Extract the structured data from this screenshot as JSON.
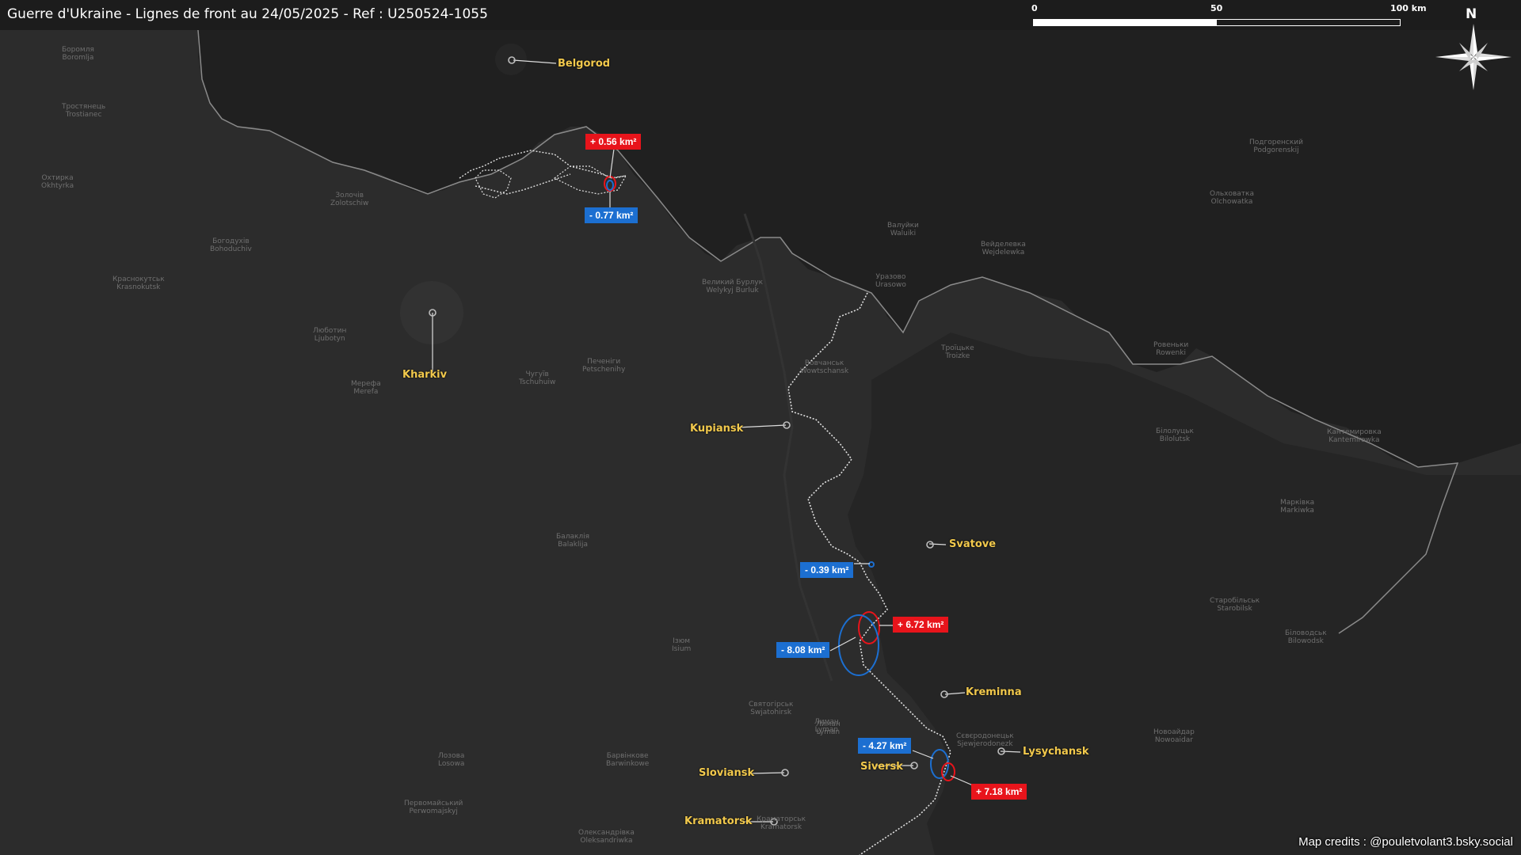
{
  "title": "Guerre d'Ukraine - Lignes de front au 24/05/2025 - Ref : U250524-1055",
  "scale": {
    "labels": [
      "0",
      "50",
      "100 km"
    ]
  },
  "north": {
    "label": "N",
    "icon": "compass-rose-icon"
  },
  "cities": [
    {
      "name": "Belgorod"
    },
    {
      "name": "Kharkiv"
    },
    {
      "name": "Kupiansk"
    },
    {
      "name": "Svatove"
    },
    {
      "name": "Kreminna"
    },
    {
      "name": "Lysychansk"
    },
    {
      "name": "Siversk"
    },
    {
      "name": "Sloviansk"
    },
    {
      "name": "Kramatorsk"
    }
  ],
  "changes": [
    {
      "label": "+ 0.56 km²",
      "type": "gain",
      "area_km2": 0.56
    },
    {
      "label": "- 0.77 km²",
      "type": "loss",
      "area_km2": -0.77
    },
    {
      "label": "- 0.39 km²",
      "type": "loss",
      "area_km2": -0.39
    },
    {
      "label": "+ 6.72 km²",
      "type": "gain",
      "area_km2": 6.72
    },
    {
      "label": "- 8.08 km²",
      "type": "loss",
      "area_km2": -8.08
    },
    {
      "label": "- 4.27 km²",
      "type": "loss",
      "area_km2": -4.27
    },
    {
      "label": "+ 7.18 km²",
      "type": "gain",
      "area_km2": 7.18
    }
  ],
  "background_labels": [
    "Боромля\nBoromlja",
    "Тростянець\nTrostianec",
    "Охтирка\nOkhtyrka",
    "Богодухів\nBohoduchiv",
    "Золочів\nZolotschiw",
    "Краснокутськ\nKrasnokutsk",
    "Люботин\nLjubotyn",
    "Мерефа\nMerefa",
    "Чугуїв\nTschuhuiw",
    "Печеніги\nPetschenihy",
    "Балаклія\nBalaklija",
    "Ізюм\nIsium",
    "Вовчанськ\nWowtschansk",
    "Великий Бурлук\nWelykyj Burluk",
    "Троїцьке\nTroizke",
    "Білолуцьк\nBilolutsk",
    "Марківка\nMarkiwka",
    "Старобільськ\nStarobilsk",
    "Біловодськ\nBilowodsk",
    "Новоайдар\nNowoaidar",
    "Сєвєродонецьк\nSjewjerodonezk",
    "Лиман\nLyman",
    "Святогірськ\nSwjatohirsk",
    "Барвінкове\nBarwinkowe",
    "Лозова\nLosowa",
    "Первомайський\nPerwomajskyj",
    "Подгоренский\nPodgorenskij",
    "Ольховатка\nOlchowatka",
    "Валуйки\nWaluiki",
    "Вейделевка\nWejdelewka",
    "Уразово\nUrasowo",
    "Ровеньки\nRowenki",
    "Кантемировка\nKantemirowka",
    "Олександрівка\nOleksandriwka",
    "Лиман\nLyman",
    "Краматорськ\nKramatorsk"
  ],
  "credits": "Map credits : @pouletvolant3.bsky.social",
  "colors": {
    "background": "#2b2b2b",
    "russia": "#202020",
    "frontline": "#ffffff",
    "gain": "#e8141b",
    "loss": "#1c6fd1",
    "city_label": "#f2c94c"
  }
}
